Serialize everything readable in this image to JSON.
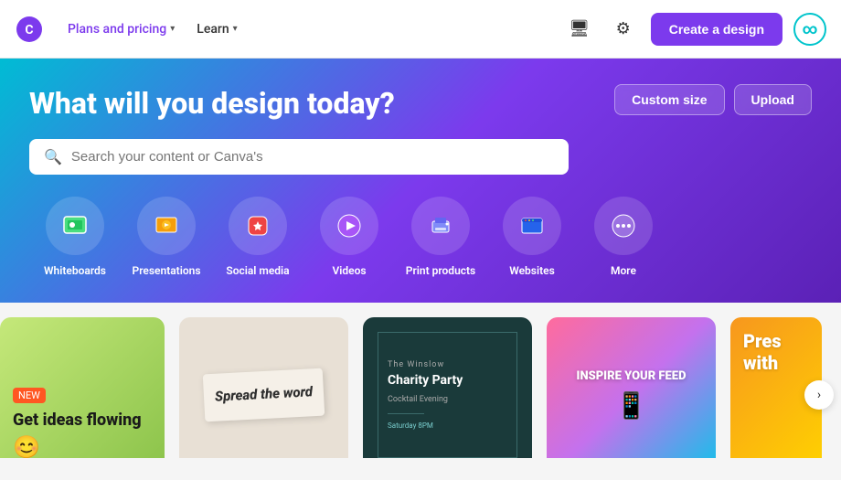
{
  "header": {
    "nav": [
      {
        "label": "Plans and pricing",
        "has_dropdown": true,
        "accent": true
      },
      {
        "label": "Learn",
        "has_dropdown": true,
        "accent": false
      }
    ],
    "create_btn_label": "Create a design",
    "monitor_icon": "monitor-icon",
    "gear_icon": "gear-icon",
    "infinity_icon": "∞"
  },
  "hero": {
    "title": "What will you design today?",
    "search_placeholder": "Search your content or Canva's",
    "custom_size_label": "Custom size",
    "upload_label": "Upload"
  },
  "categories": [
    {
      "id": "whiteboards",
      "label": "Whiteboards",
      "emoji": "🟩"
    },
    {
      "id": "presentations",
      "label": "Presentations",
      "emoji": "💬"
    },
    {
      "id": "social-media",
      "label": "Social media",
      "emoji": "❤️"
    },
    {
      "id": "videos",
      "label": "Videos",
      "emoji": "▶️"
    },
    {
      "id": "print-products",
      "label": "Print products",
      "emoji": "🖨️"
    },
    {
      "id": "websites",
      "label": "Websites",
      "emoji": "💻"
    },
    {
      "id": "more",
      "label": "More",
      "emoji": "···"
    }
  ],
  "cards": [
    {
      "id": "card-ideas",
      "title": "Get ideas flowing",
      "bg": "#7ecb4a"
    },
    {
      "id": "card-spread",
      "title": "Spread the word",
      "bg": "#e8e0d5"
    },
    {
      "id": "card-winslow",
      "subtitle": "The Winslow",
      "event": "Charity Party",
      "bg": "#1a3a3a"
    },
    {
      "id": "card-inspire",
      "title": "INSPIRE YOUR FEED",
      "bg": "#c471ed"
    },
    {
      "id": "card-pres",
      "title": "Pres with",
      "bg": "#f7971e"
    }
  ],
  "scroll": {
    "chevron": "›"
  }
}
